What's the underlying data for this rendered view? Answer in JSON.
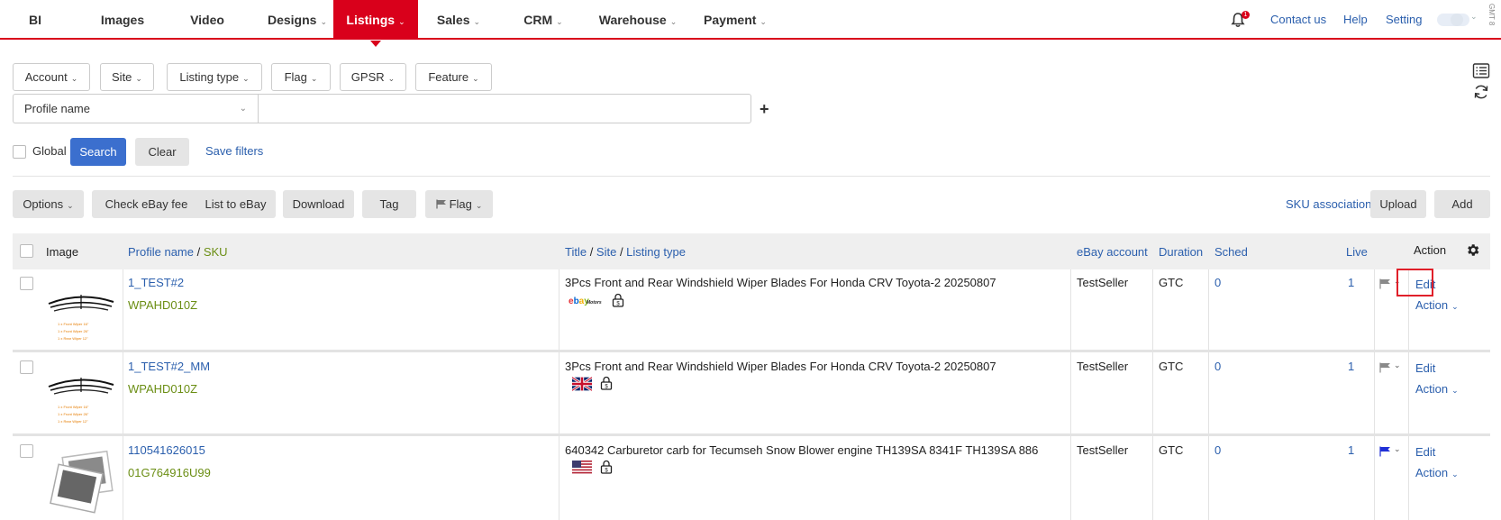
{
  "nav": {
    "items": [
      {
        "label": "BI"
      },
      {
        "label": "Images"
      },
      {
        "label": "Video"
      },
      {
        "label": "Designs"
      },
      {
        "label": "Listings"
      },
      {
        "label": "Sales"
      },
      {
        "label": "CRM"
      },
      {
        "label": "Warehouse"
      },
      {
        "label": "Payment"
      }
    ],
    "active": "Listings",
    "notification_count": "1",
    "contact": "Contact us",
    "help": "Help",
    "setting": "Setting",
    "gmt": "GMT 8"
  },
  "filters": {
    "buttons": [
      "Account",
      "Site",
      "Listing type",
      "Flag",
      "GPSR",
      "Feature"
    ],
    "profile_select": "Profile name",
    "profile_input_value": "",
    "global_label": "Global",
    "search_label": "Search",
    "clear_label": "Clear",
    "save_filters_label": "Save filters"
  },
  "toolbar": {
    "options": "Options",
    "check_fee": "Check eBay fee",
    "list_to_ebay": "List to eBay",
    "download": "Download",
    "tag": "Tag",
    "flag": "Flag",
    "sku_association": "SKU association",
    "upload": "Upload",
    "add": "Add"
  },
  "table": {
    "headers": {
      "image": "Image",
      "profile_name": "Profile name",
      "sku": "SKU",
      "title": "Title",
      "site": "Site",
      "listing_type": "Listing type",
      "ebay_account": "eBay account",
      "duration": "Duration",
      "sched": "Sched",
      "live": "Live",
      "action": "Action"
    },
    "rows": [
      {
        "profile": "1_TEST#2",
        "sku": "WPAHD010Z",
        "title": "3Pcs Front and Rear Windshield Wiper Blades For Honda CRV Toyota-2 20250807",
        "site": "ebay-motors",
        "account": "TestSeller",
        "duration": "GTC",
        "sched": "0",
        "live": "1",
        "edit": "Edit",
        "action": "Action",
        "thumb_lines": [
          "1 x Front Wiper 16\"",
          "1 x Front Wiper 26\"",
          "1 x Rear Wiper 12\""
        ]
      },
      {
        "profile": "1_TEST#2_MM",
        "sku": "WPAHD010Z",
        "title": "3Pcs Front and Rear Windshield Wiper Blades For Honda CRV Toyota-2 20250807",
        "site": "uk",
        "account": "TestSeller",
        "duration": "GTC",
        "sched": "0",
        "live": "1",
        "edit": "Edit",
        "action": "Action",
        "thumb_lines": [
          "1 x Front Wiper 16\"",
          "1 x Front Wiper 26\"",
          "1 x Rear Wiper 12\""
        ]
      },
      {
        "profile": "110541626015",
        "sku": "01G764916U99",
        "title": "640342 Carburetor carb for Tecumseh Snow Blower engine TH139SA 8341F TH139SA 886",
        "site": "us",
        "account": "TestSeller",
        "duration": "GTC",
        "sched": "0",
        "live": "1",
        "edit": "Edit",
        "action": "Action"
      }
    ]
  },
  "colors": {
    "brand_red": "#d9001b",
    "link_blue": "#2b5fad",
    "sku_green": "#6b8e14",
    "search_blue": "#3b6fce"
  }
}
